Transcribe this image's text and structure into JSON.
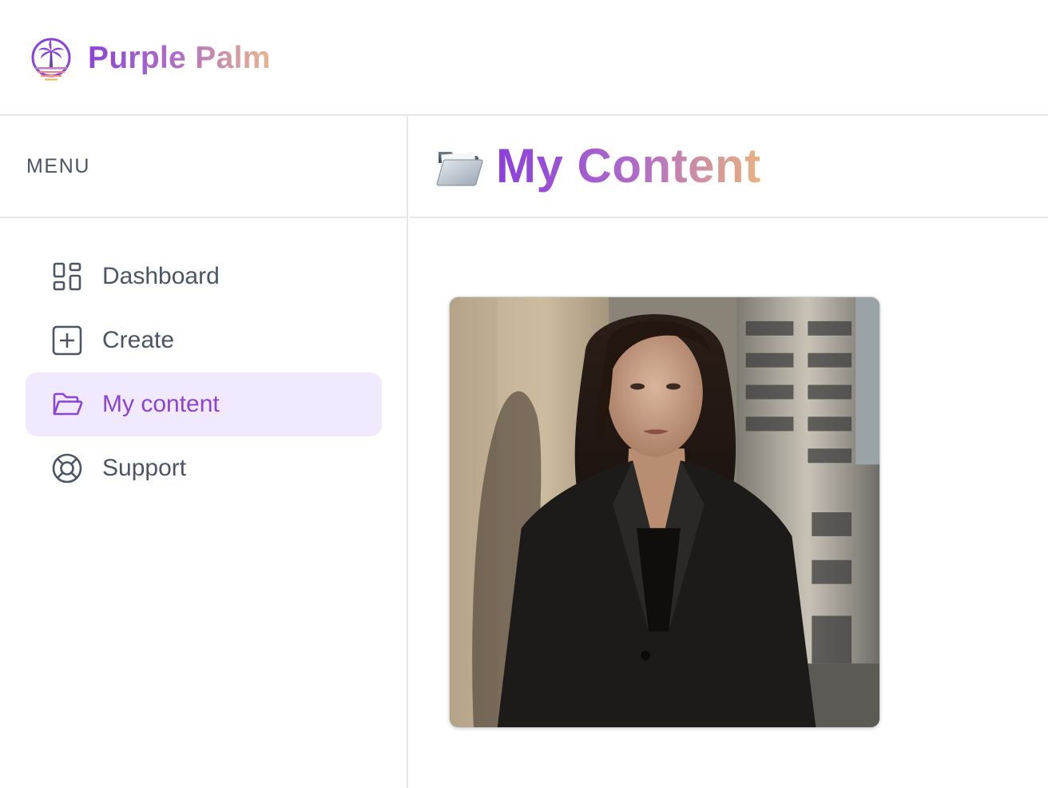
{
  "brand": {
    "name": "Purple Palm",
    "accent": "#8b45d6",
    "accent_end": "#e8b58a"
  },
  "sidebar": {
    "menu_label": "MENU",
    "items": [
      {
        "label": "Dashboard",
        "icon": "dashboard-grid-icon",
        "active": false
      },
      {
        "label": "Create",
        "icon": "plus-square-icon",
        "active": false
      },
      {
        "label": "My content",
        "icon": "folder-open-icon",
        "active": true
      },
      {
        "label": "Support",
        "icon": "lifebuoy-icon",
        "active": false
      }
    ]
  },
  "main": {
    "title_icon": "folder-emoji-icon",
    "title": "My Content",
    "items": [
      {
        "type": "image",
        "subject": "content-thumbnail"
      }
    ]
  },
  "colors": {
    "active_bg": "#f1e9fd",
    "border": "#e5e7eb",
    "text": "#4b5563"
  }
}
